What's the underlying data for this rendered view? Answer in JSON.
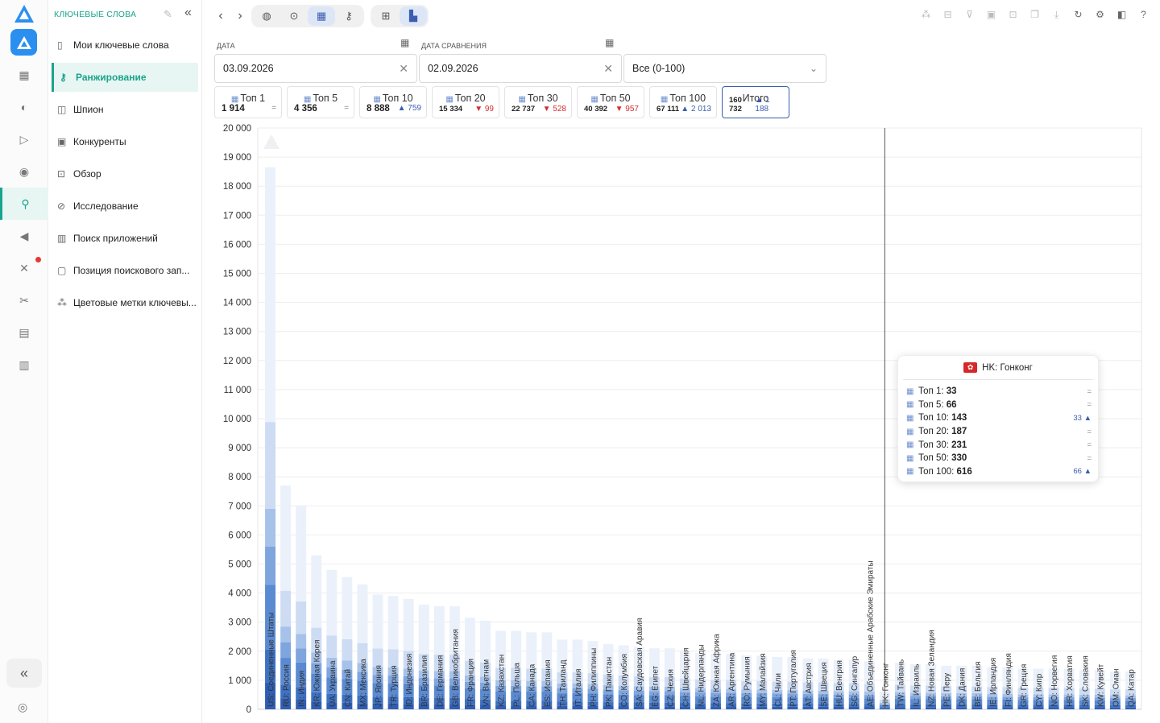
{
  "sidebar": {
    "header": "Ключевые слова",
    "items": [
      {
        "label": "Мои ключевые слова",
        "icon": "bookmark-icon"
      },
      {
        "label": "Ранжирование",
        "icon": "key-icon",
        "active": true
      },
      {
        "label": "Шпион",
        "icon": "spy-icon"
      },
      {
        "label": "Конкуренты",
        "icon": "competitors-icon"
      },
      {
        "label": "Обзор",
        "icon": "overview-icon"
      },
      {
        "label": "Исследование",
        "icon": "research-icon"
      },
      {
        "label": "Поиск приложений",
        "icon": "bar-chart-icon"
      },
      {
        "label": "Позиция поискового зап...",
        "icon": "document-icon"
      },
      {
        "label": "Цветовые метки ключевы...",
        "icon": "color-tags-icon"
      }
    ]
  },
  "filters": {
    "date_label": "Дата",
    "date_value": "03.09.2026",
    "compare_label": "Дата сравнения",
    "compare_value": "02.09.2026",
    "range_value": "Все (0-100)"
  },
  "cards": [
    {
      "title": "Топ 1",
      "value": "1 914",
      "delta": "=",
      "dir": "eq"
    },
    {
      "title": "Топ 5",
      "value": "4 356",
      "delta": "=",
      "dir": "eq"
    },
    {
      "title": "Топ 10",
      "value": "8 888",
      "delta": "▲ 759",
      "dir": "up"
    },
    {
      "title": "Топ 20",
      "value": "15 334",
      "delta": "▼ 99",
      "dir": "down"
    },
    {
      "title": "Топ 30",
      "value": "22 737",
      "delta": "▼ 528",
      "dir": "down"
    },
    {
      "title": "Топ 50",
      "value": "40 392",
      "delta": "▼ 957",
      "dir": "down"
    },
    {
      "title": "Топ 100",
      "value": "67 111",
      "delta": "▲ 2 013",
      "dir": "up"
    },
    {
      "title": "Итого",
      "value": "160 732",
      "delta": "▲ 1 188",
      "dir": "up"
    }
  ],
  "tooltip": {
    "country": "HK: Гонконг",
    "rows": [
      {
        "label": "Топ 1:",
        "value": "33",
        "delta": "="
      },
      {
        "label": "Топ 5:",
        "value": "66",
        "delta": "="
      },
      {
        "label": "Топ 10:",
        "value": "143",
        "delta": "33 ▲"
      },
      {
        "label": "Топ 20:",
        "value": "187",
        "delta": "="
      },
      {
        "label": "Топ 30:",
        "value": "231",
        "delta": "="
      },
      {
        "label": "Топ 50:",
        "value": "330",
        "delta": "="
      },
      {
        "label": "Топ 100:",
        "value": "616",
        "delta": "66 ▲"
      }
    ]
  },
  "colors": {
    "accent": "#1aa38c",
    "bar_shades": [
      "#2f5fb4",
      "#3d71c4",
      "#5a8ad2",
      "#7fa5de",
      "#a7c2ea",
      "#cddcf3",
      "#ebf1fb"
    ]
  },
  "chart_data": {
    "type": "bar",
    "stacked": true,
    "ylim": [
      0,
      20000
    ],
    "yticks": [
      "0",
      "1 000",
      "2 000",
      "3 000",
      "4 000",
      "5 000",
      "6 000",
      "7 000",
      "8 000",
      "9 000",
      "10 000",
      "11 000",
      "12 000",
      "13 000",
      "14 000",
      "15 000",
      "16 000",
      "17 000",
      "18 000",
      "19 000",
      "20 000"
    ],
    "categories": [
      "US: Соединенные Штаты",
      "RU: Россия",
      "IN: Индия",
      "KR: Южная Корея",
      "UA: Украина",
      "CN: Китай",
      "MX: Мексика",
      "JP: Япония",
      "TR: Турция",
      "ID: Индонезия",
      "BR: Бразилия",
      "DE: Германия",
      "GB: Великобритания",
      "FR: Франция",
      "VN: Вьетнам",
      "KZ: Казахстан",
      "PL: Польша",
      "CA: Канада",
      "ES: Испания",
      "TH: Таиланд",
      "IT: Италия",
      "PH: Филиппины",
      "PK: Пакистан",
      "CO: Колумбия",
      "SA: Саудовская Аравия",
      "EG: Египет",
      "CZ: Чехия",
      "CH: Швейцария",
      "NL: Нидерланды",
      "ZA: Южная Африка",
      "AR: Аргентина",
      "RO: Румыния",
      "MY: Малайзия",
      "CL: Чили",
      "PT: Португалия",
      "AT: Австрия",
      "SE: Швеция",
      "HU: Венгрия",
      "SG: Сингапур",
      "AE: Объединенные Арабские Эмираты",
      "HK: Гонконг",
      "TW: Тайвань",
      "IL: Израиль",
      "NZ: Новая Зеландия",
      "PE: Перу",
      "DK: Дания",
      "BE: Бельгия",
      "IE: Ирландия",
      "FI: Финляндия",
      "GR: Греция",
      "CY: Кипр",
      "NO: Норвегия",
      "HR: Хорватия",
      "SK: Словакия",
      "KW: Кувейт",
      "OM: Оман",
      "QA: Катар"
    ],
    "totals": [
      18650,
      7700,
      7000,
      5300,
      4800,
      4550,
      4300,
      3950,
      3900,
      3800,
      3600,
      3550,
      3550,
      3150,
      3050,
      2700,
      2700,
      2650,
      2650,
      2400,
      2400,
      2350,
      2250,
      2200,
      2150,
      2100,
      2100,
      2000,
      1950,
      1900,
      1900,
      1850,
      1850,
      1800,
      1800,
      1750,
      1750,
      1700,
      1700,
      1650,
      616,
      1600,
      1550,
      1550,
      1500,
      1500,
      1500,
      1450,
      1450,
      1400,
      1400,
      1400,
      1400,
      1350,
      1350,
      1300,
      1300
    ],
    "highlight": "HK: Гонконг",
    "series_names": [
      "Топ 1",
      "Топ 5",
      "Топ 10",
      "Топ 20",
      "Топ 30",
      "Топ 50",
      "Топ 100"
    ]
  }
}
